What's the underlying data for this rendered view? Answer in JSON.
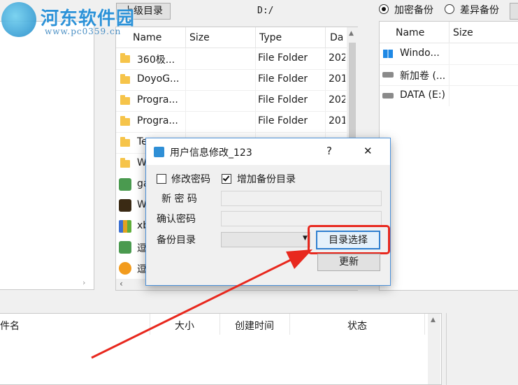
{
  "watermark": {
    "title": "河东软件园",
    "url": "www.pc0359.cn"
  },
  "toolbar": {
    "up_button": "上级目录",
    "path": "D:/"
  },
  "backup_mode": {
    "option1": "加密备份",
    "option2": "差异备份"
  },
  "file_list": {
    "columns": [
      "Name",
      "Size",
      "Type",
      "Da"
    ],
    "rows": [
      {
        "name": "360极...",
        "type": "File Folder",
        "date": "202"
      },
      {
        "name": "DoyoG...",
        "type": "File Folder",
        "date": "201"
      },
      {
        "name": "Progra...",
        "type": "File Folder",
        "date": "202"
      },
      {
        "name": "Progra...",
        "type": "File Folder",
        "date": "201"
      },
      {
        "name": "Te"
      },
      {
        "name": "W"
      },
      {
        "name": "ga"
      },
      {
        "name": "W"
      },
      {
        "name": "xb"
      },
      {
        "name": "逗"
      },
      {
        "name": "逗"
      }
    ]
  },
  "drives": {
    "columns": [
      "Name",
      "Size"
    ],
    "rows": [
      "Windo...",
      "新加卷 (...",
      "DATA (E:)"
    ]
  },
  "bottom_table": {
    "columns": [
      "件名",
      "大小",
      "创建时间",
      "状态"
    ]
  },
  "dialog": {
    "title": "用户信息修改_123",
    "help": "?",
    "close": "✕",
    "chk_password": "修改密码",
    "chk_add_dir": "增加备份目录",
    "label_new_pw": "新 密 码",
    "label_confirm_pw": "确认密码",
    "label_backup_dir": "备份目录",
    "btn_select_dir": "目录选择",
    "btn_update": "更新"
  },
  "colors": {
    "highlight": "#e8281e",
    "accent": "#2b7bd6"
  }
}
